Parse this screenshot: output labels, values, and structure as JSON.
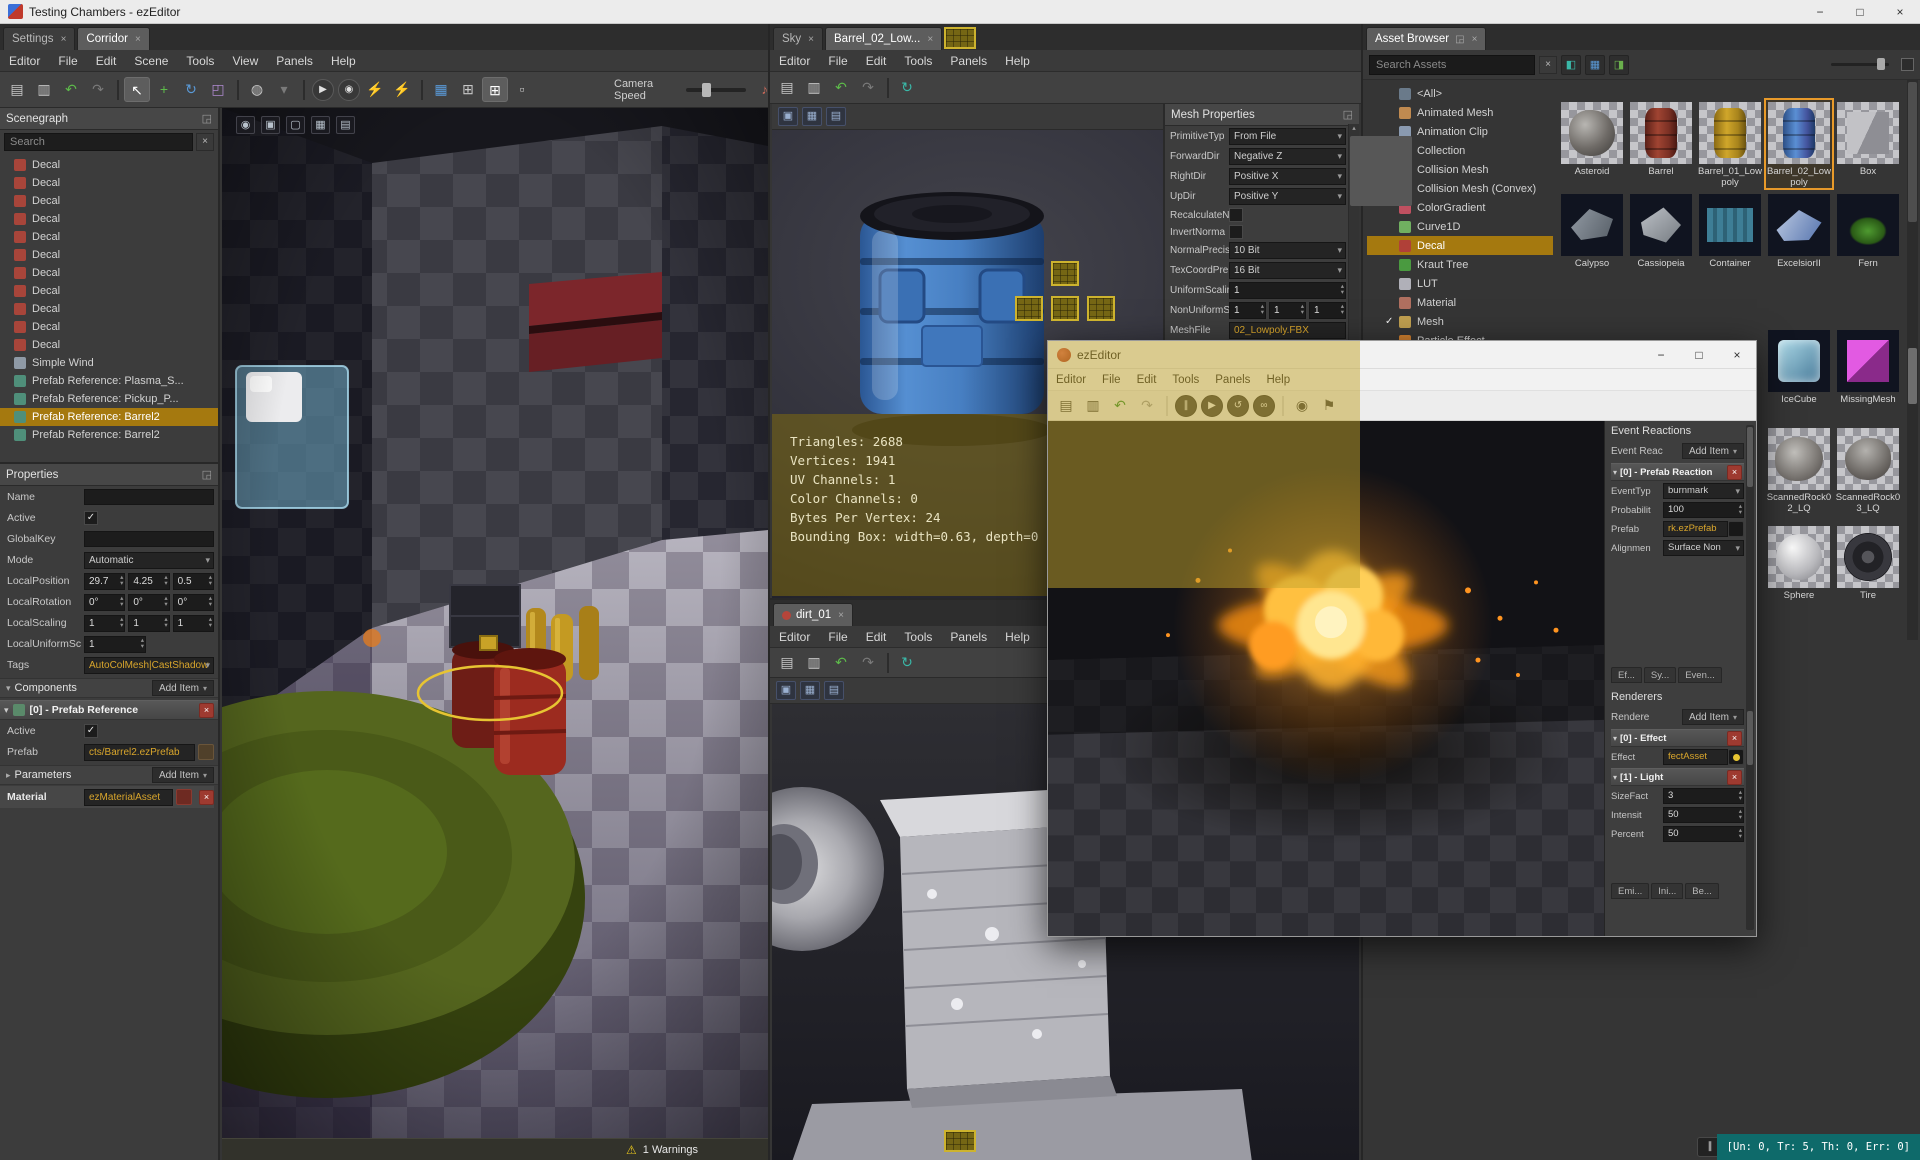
{
  "icons": {
    "close": "×",
    "float": "◲",
    "caret_down": "▾",
    "caret_right": "▸",
    "check": "✓",
    "warning": "⚠",
    "spin_up": "▴",
    "spin_down": "▾",
    "minimize": "−",
    "maximize": "□",
    "audio": "♪",
    "pause": "∥"
  },
  "titlebar": {
    "title": "Testing Chambers - ezEditor"
  },
  "statusbar": {
    "stats": "[Un: 0, Tr: 5, Th: 0, Err: 0]"
  },
  "scene_window": {
    "tabs": [
      {
        "label": "Settings",
        "cls": ""
      },
      {
        "label": "Corridor",
        "cls": "active"
      }
    ],
    "menus": [
      "Editor",
      "File",
      "Edit",
      "Scene",
      "Tools",
      "View",
      "Panels",
      "Help"
    ],
    "toolbar_icons": [
      {
        "name": "save-icon",
        "glyph": "▤",
        "cls": ""
      },
      {
        "name": "save-all-icon",
        "glyph": "▥",
        "cls": ""
      },
      {
        "name": "undo-icon",
        "glyph": "↶",
        "cls": "green"
      },
      {
        "name": "redo-icon",
        "glyph": "↷",
        "cls": "dim"
      },
      {
        "name": "separator",
        "glyph": "",
        "cls": "sep"
      },
      {
        "name": "select-tool-icon",
        "glyph": "↖",
        "cls": "activebox"
      },
      {
        "name": "translate-tool-icon",
        "glyph": "+",
        "cls": "green"
      },
      {
        "name": "rotate-tool-icon",
        "glyph": "↻",
        "cls": "blue"
      },
      {
        "name": "scale-tool-icon",
        "glyph": "◰",
        "cls": "purple"
      },
      {
        "name": "separator",
        "glyph": "",
        "cls": "sep"
      },
      {
        "name": "world-space-icon",
        "glyph": "◍",
        "cls": ""
      },
      {
        "name": "gizmo-options-icon",
        "glyph": "▾",
        "cls": "dim"
      },
      {
        "name": "separator",
        "glyph": "",
        "cls": "sep"
      },
      {
        "name": "play-game-icon",
        "glyph": "▶",
        "cls": "circle"
      },
      {
        "name": "simulate-icon",
        "glyph": "◉",
        "cls": "circle"
      },
      {
        "name": "export-run-icon",
        "glyph": "⚡",
        "cls": "gold"
      },
      {
        "name": "run-project-icon",
        "glyph": "⚡",
        "cls": "gold"
      },
      {
        "name": "separator",
        "glyph": "",
        "cls": "sep"
      },
      {
        "name": "grid-icon",
        "glyph": "▦",
        "cls": "blue"
      },
      {
        "name": "snap-position-icon",
        "glyph": "⊞",
        "cls": ""
      },
      {
        "name": "snap-rotation-icon",
        "glyph": "⊞",
        "cls": "activebox"
      },
      {
        "name": "snap-scale-icon",
        "glyph": "▫",
        "cls": ""
      }
    ],
    "camera_speed_label": "Camera Speed",
    "scenegraph": {
      "title": "Scenegraph",
      "search_placeholder": "Search",
      "items": [
        {
          "label": "Decal",
          "color": "#a8453a",
          "cls": ""
        },
        {
          "label": "Decal",
          "color": "#a8453a",
          "cls": ""
        },
        {
          "label": "Decal",
          "color": "#a8453a",
          "cls": ""
        },
        {
          "label": "Decal",
          "color": "#a8453a",
          "cls": ""
        },
        {
          "label": "Decal",
          "color": "#a8453a",
          "cls": ""
        },
        {
          "label": "Decal",
          "color": "#a8453a",
          "cls": ""
        },
        {
          "label": "Decal",
          "color": "#a8453a",
          "cls": ""
        },
        {
          "label": "Decal",
          "color": "#a8453a",
          "cls": ""
        },
        {
          "label": "Decal",
          "color": "#a8453a",
          "cls": ""
        },
        {
          "label": "Decal",
          "color": "#a8453a",
          "cls": ""
        },
        {
          "label": "Decal",
          "color": "#a8453a",
          "cls": ""
        },
        {
          "label": "Simple Wind",
          "color": "#8f9aa6",
          "cls": ""
        },
        {
          "label": "Prefab Reference: Plasma_S...",
          "color": "#4f8f7a",
          "cls": ""
        },
        {
          "label": "Prefab Reference: Pickup_P...",
          "color": "#4f8f7a",
          "cls": ""
        },
        {
          "label": "Prefab Reference: Barrel2",
          "color": "#4f8f7a",
          "cls": "selected"
        },
        {
          "label": "Prefab Reference: Barrel2",
          "color": "#4f8f7a",
          "cls": ""
        }
      ]
    },
    "properties": {
      "title": "Properties",
      "name_label": "Name",
      "active_label": "Active",
      "globalkey_label": "GlobalKey",
      "mode_label": "Mode",
      "mode_value": "Automatic",
      "position_label": "LocalPosition",
      "position_values": [
        "29.7",
        "4.25",
        "0.5"
      ],
      "rotation_label": "LocalRotation",
      "rotation_values": [
        "0°",
        "0°",
        "0°"
      ],
      "scaling_label": "LocalScaling",
      "scaling_values": [
        "1",
        "1",
        "1"
      ],
      "uniform_label": "LocalUniformSc",
      "uniform_value": "1",
      "tags_label": "Tags",
      "tags_value": "AutoColMesh|CastShadow",
      "components_label": "Components",
      "add_item_label": "Add Item",
      "component0_header": "[0] - Prefab Reference",
      "comp_active_label": "Active",
      "prefab_label": "Prefab",
      "prefab_value": "cts/Barrel2.ezPrefab",
      "parameters_label": "Parameters",
      "material_label": "Material",
      "material_value": "ezMaterialAsset"
    },
    "viewport_icons": [
      {
        "name": "camera-views-icon",
        "glyph": "◉"
      },
      {
        "name": "render-mode-icon",
        "glyph": "▣"
      },
      {
        "name": "maximize-viewport-icon",
        "glyph": "▢"
      },
      {
        "name": "grid-toggle-icon",
        "glyph": "▦"
      },
      {
        "name": "screenshot-icon",
        "glyph": "▤"
      }
    ],
    "warnings_label": "1 Warnings"
  },
  "mesh_window": {
    "tabs": [
      {
        "label": "Sky",
        "cls": ""
      },
      {
        "label": "Barrel_02_Low...",
        "cls": "active"
      }
    ],
    "menus": [
      "Editor",
      "File",
      "Edit",
      "Tools",
      "Panels",
      "Help"
    ],
    "toolbar_icons": [
      {
        "name": "save-icon",
        "glyph": "▤",
        "cls": ""
      },
      {
        "name": "save-all-icon",
        "glyph": "▥",
        "cls": ""
      },
      {
        "name": "undo-icon",
        "glyph": "↶",
        "cls": "green"
      },
      {
        "name": "redo-icon",
        "glyph": "↷",
        "cls": "dim"
      },
      {
        "name": "separator",
        "glyph": "",
        "cls": "sep"
      },
      {
        "name": "asset-transform-icon",
        "glyph": "↻",
        "cls": "teal"
      }
    ],
    "viewport_icons": [
      {
        "name": "render-mode-icon",
        "glyph": "▣"
      },
      {
        "name": "view-settings-icon",
        "glyph": "▦"
      },
      {
        "name": "screenshot-icon",
        "glyph": "▤"
      }
    ],
    "mesh_properties": {
      "title": "Mesh Properties",
      "primitive_label": "PrimitiveTyp",
      "primitive_value": "From File",
      "forward_label": "ForwardDir",
      "forward_value": "Negative Z",
      "right_label": "RightDir",
      "right_value": "Positive X",
      "up_label": "UpDir",
      "up_value": "Positive Y",
      "recalc_label": "RecalculateN",
      "invert_label": "InvertNorma",
      "normalprec_label": "NormalPrecis",
      "normalprec_value": "10 Bit",
      "texcoord_label": "TexCoordPre",
      "texcoord_value": "16 Bit",
      "uniformscale_label": "UniformScalir",
      "uniformscale_value": "1",
      "nonuniform_label": "NonUniformS",
      "nonuniform_values": [
        "1",
        "1",
        "1"
      ],
      "meshfile_label": "MeshFile",
      "meshfile_value": "02_Lowpoly.FBX"
    },
    "stats": [
      "Triangles: 2688",
      "Vertices: 1941",
      "UV Channels: 1",
      "Color Channels: 0",
      "Bytes Per Vertex: 24",
      "Bounding Box: width=0.63, depth=0"
    ]
  },
  "dirt_window": {
    "tab": "dirt_01",
    "menus": [
      "Editor",
      "File",
      "Edit",
      "Tools",
      "Panels",
      "Help"
    ],
    "toolbar_icons": [
      {
        "name": "save-icon",
        "glyph": "▤",
        "cls": ""
      },
      {
        "name": "save-all-icon",
        "glyph": "▥",
        "cls": ""
      },
      {
        "name": "undo-icon",
        "glyph": "↶",
        "cls": "green"
      },
      {
        "name": "redo-icon",
        "glyph": "↷",
        "cls": "dim"
      },
      {
        "name": "separator",
        "glyph": "",
        "cls": "sep"
      },
      {
        "name": "asset-transform-icon",
        "glyph": "↻",
        "cls": "teal"
      }
    ],
    "viewport_icons": [
      {
        "name": "render-mode-icon",
        "glyph": "▣"
      },
      {
        "name": "view-settings-icon",
        "glyph": "▦"
      },
      {
        "name": "screenshot-icon",
        "glyph": "▤"
      }
    ]
  },
  "particle_window": {
    "title": "ezEditor",
    "menus": [
      "Editor",
      "File",
      "Edit",
      "Tools",
      "Panels",
      "Help"
    ],
    "toolbar_icons": [
      {
        "name": "save-icon",
        "glyph": "▤",
        "cls": ""
      },
      {
        "name": "save-all-icon",
        "glyph": "▥",
        "cls": ""
      },
      {
        "name": "undo-icon",
        "glyph": "↶",
        "cls": "green"
      },
      {
        "name": "redo-icon",
        "glyph": "↷",
        "cls": "dim"
      },
      {
        "name": "separator",
        "glyph": "",
        "cls": "sep"
      },
      {
        "name": "pause-icon",
        "glyph": "∥",
        "cls": "circle"
      },
      {
        "name": "play-icon",
        "glyph": "▶",
        "cls": "circle"
      },
      {
        "name": "restart-icon",
        "glyph": "↺",
        "cls": "circle"
      },
      {
        "name": "loop-icon",
        "glyph": "∞",
        "cls": "circle"
      },
      {
        "name": "separator",
        "glyph": "",
        "cls": "sep"
      },
      {
        "name": "simulate-icon",
        "glyph": "◉",
        "cls": ""
      },
      {
        "name": "flag-icon",
        "glyph": "⚑",
        "cls": ""
      }
    ],
    "event_reactions": {
      "title": "Event Reactions",
      "list_label": "Event Reac",
      "add_item_label": "Add Item",
      "group_header": "[0] - Prefab Reaction",
      "eventtype_label": "EventTyp",
      "eventtype_value": "burnmark",
      "probability_label": "Probabilit",
      "probability_value": "100",
      "prefab_label": "Prefab",
      "prefab_value": "rk.ezPrefab",
      "alignment_label": "Alignmen",
      "alignment_value": "Surface Non",
      "tabs": [
        "Ef...",
        "Sy...",
        "Even..."
      ]
    },
    "renderers": {
      "title": "Renderers",
      "list_label": "Rendere",
      "add_item_label": "Add Item",
      "group0_header": "[0] - Effect",
      "effect_label": "Effect",
      "effect_value": "fectAsset",
      "group1_header": "[1] - Light",
      "sizefactor_label": "SizeFact",
      "sizefactor_value": "3",
      "intensity_label": "Intensit",
      "intensity_value": "50",
      "percentage_label": "Percent",
      "percentage_value": "50",
      "tabs": [
        "Emi...",
        "Ini...",
        "Be..."
      ]
    }
  },
  "asset_browser": {
    "tab": "Asset Browser",
    "search_placeholder": "Search Assets",
    "filter_icons": [
      {
        "name": "filter-assets-icon",
        "glyph": "◧",
        "cls": "teal"
      },
      {
        "name": "show-items-icon",
        "glyph": "▦",
        "cls": "blue"
      },
      {
        "name": "transform-all-icon",
        "glyph": "◨",
        "cls": "green"
      }
    ],
    "tree": [
      {
        "label": "<All>",
        "color": "#6a7a8a",
        "cls": ""
      },
      {
        "label": "Animated Mesh",
        "color": "#c08a50",
        "cls": ""
      },
      {
        "label": "Animation Clip",
        "color": "#8a9ab0",
        "cls": ""
      },
      {
        "label": "Collection",
        "color": "#c0b050",
        "cls": ""
      },
      {
        "label": "Collision Mesh",
        "color": "#5a9ab8",
        "cls": ""
      },
      {
        "label": "Collision Mesh (Convex)",
        "color": "#5ab8a8",
        "cls": ""
      },
      {
        "label": "ColorGradient",
        "color": "#c05060",
        "cls": ""
      },
      {
        "label": "Curve1D",
        "color": "#70b060",
        "cls": ""
      },
      {
        "label": "Decal",
        "color": "#b04038",
        "cls": "selected"
      },
      {
        "label": "Kraut Tree",
        "color": "#4a9a40",
        "cls": ""
      },
      {
        "label": "LUT",
        "color": "#b0b0b8",
        "cls": ""
      },
      {
        "label": "Material",
        "color": "#b07060",
        "cls": ""
      },
      {
        "label": "Mesh",
        "color": "#c0a050",
        "cls": "",
        "checked": "✓"
      },
      {
        "label": "Particle Effect",
        "color": "#d08030",
        "cls": ""
      }
    ],
    "assets": [
      {
        "name": "Asteroid",
        "cls": "pos-r1c1 thumb-asteroid chklight"
      },
      {
        "name": "Barrel",
        "cls": "pos-r1c2 thumb-barrel chklight"
      },
      {
        "name": "Barrel_01_Lowpoly",
        "cls": "pos-r1c3 thumb-barrel1 chklight"
      },
      {
        "name": "Barrel_02_Lowpoly",
        "cls": "pos-r1c4 thumb-barrel2 chklight selected"
      },
      {
        "name": "Box",
        "cls": "pos-r1c5 thumb-box chklight"
      },
      {
        "name": "Calypso",
        "cls": "pos-r2c1 thumb-ship1"
      },
      {
        "name": "Cassiopeia",
        "cls": "pos-r2c2 thumb-ship2"
      },
      {
        "name": "Container",
        "cls": "pos-r2c3 thumb-container"
      },
      {
        "name": "ExcelsiorII",
        "cls": "pos-r2c4 thumb-ship3"
      },
      {
        "name": "Fern",
        "cls": "pos-r2c5 thumb-fern"
      },
      {
        "name": "IceCube",
        "cls": "pos-r3c4 thumb-ice"
      },
      {
        "name": "MissingMesh",
        "cls": "pos-r3c5 thumb-missing"
      },
      {
        "name": "ScannedRock02_LQ",
        "cls": "pos-r4c4 thumb-rock2 chklight"
      },
      {
        "name": "ScannedRock03_LQ",
        "cls": "pos-r4c5 thumb-rock3 chklight"
      },
      {
        "name": "Sphere",
        "cls": "pos-r5c4 thumb-sphere chklight"
      },
      {
        "name": "Tire",
        "cls": "pos-r5c5 thumb-tire chklight"
      }
    ]
  }
}
